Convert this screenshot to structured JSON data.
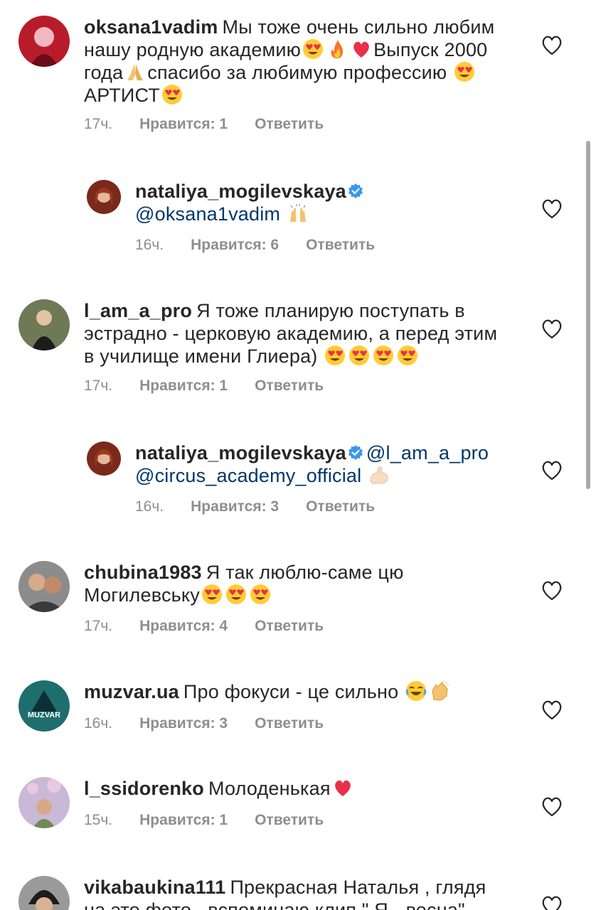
{
  "comments": [
    {
      "username": "oksana1vadim",
      "text_parts": [
        "Мы тоже очень сильно любим нашу родную академию",
        "",
        " ",
        "Выпуск 2000 года",
        "спасибо за любимую профессию ",
        "АРТИСТ",
        ""
      ],
      "time": "17ч.",
      "likes": "Нравится: 1",
      "reply": "Ответить",
      "avatar_color": "#b81c2a"
    },
    {
      "username": "nataliya_mogilevskaya",
      "mention": "@oksana1vadim",
      "time": "16ч.",
      "likes": "Нравится: 6",
      "reply": "Ответить",
      "avatar_color": "#7a2a1a"
    },
    {
      "username": "l_am_a_pro",
      "text": "Я тоже планирую поступать в эстрадно - церковую академию, а перед этим в училище имени Глиера)",
      "time": "17ч.",
      "likes": "Нравится: 1",
      "reply": "Ответить",
      "avatar_color": "#4b5a3a"
    },
    {
      "username": "nataliya_mogilevskaya",
      "mention": "@l_am_a_pro",
      "mention2": "@circus_academy_official",
      "time": "16ч.",
      "likes": "Нравится: 3",
      "reply": "Ответить",
      "avatar_color": "#7a2a1a"
    },
    {
      "username": "chubina1983",
      "text": "Я так люблю-саме цю Могилевську",
      "time": "17ч.",
      "likes": "Нравится: 4",
      "reply": "Ответить",
      "avatar_color": "#6a6a6a"
    },
    {
      "username": "muzvar.ua",
      "text": "Про фокуси - це сильно ",
      "avatar_label": "MUZVAR",
      "time": "16ч.",
      "likes": "Нравится: 3",
      "reply": "Ответить",
      "avatar_color": "#1f6e6e"
    },
    {
      "username": "l_ssidorenko",
      "text": "Молоденькая",
      "time": "15ч.",
      "likes": "Нравится: 1",
      "reply": "Ответить",
      "avatar_color": "#b7a6c8"
    },
    {
      "username": "vikabaukina111",
      "text": "Прекрасная Наталья , глядя на это фото , вспоминаю клип \" Я - весна\"",
      "avatar_color": "#3a3a3a"
    }
  ],
  "colors": {
    "text": "#262626",
    "meta": "#8e8e8e",
    "mention": "#00376b",
    "verified": "#3897f0",
    "heart_emoji": "#e0245e"
  }
}
